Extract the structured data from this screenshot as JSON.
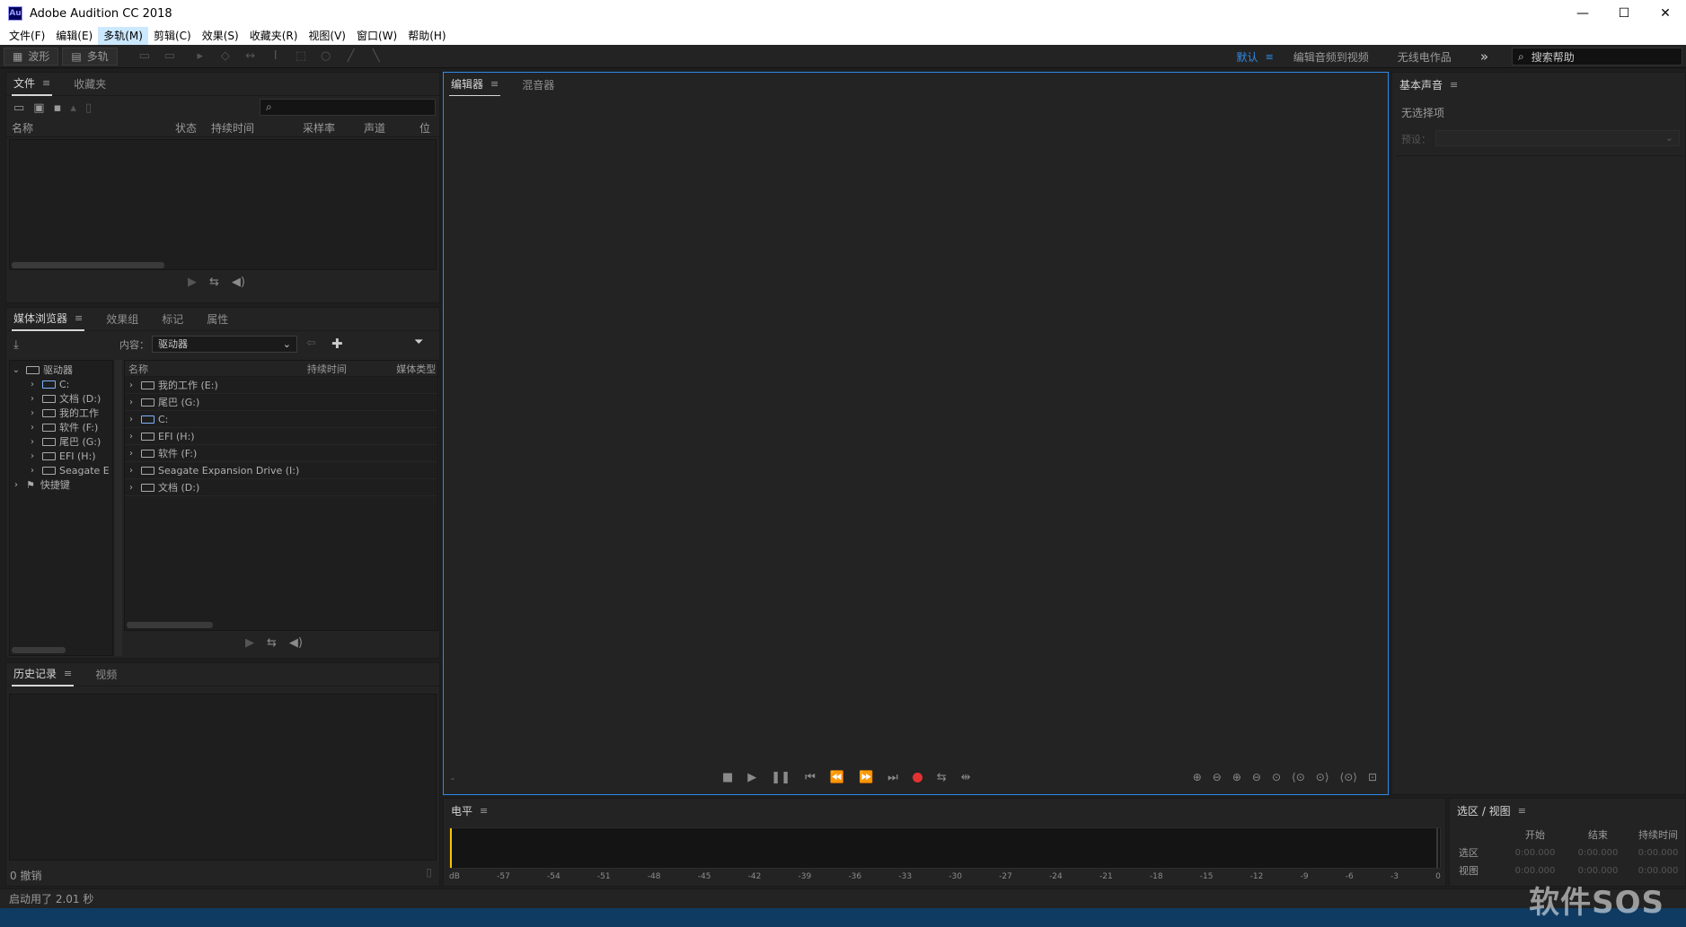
{
  "window": {
    "title": "Adobe Audition CC 2018",
    "app_icon": "Au",
    "minimize": "—",
    "maximize": "☐",
    "close": "✕"
  },
  "menu": [
    "文件(F)",
    "编辑(E)",
    "多轨(M)",
    "剪辑(C)",
    "效果(S)",
    "收藏夹(R)",
    "视图(V)",
    "窗口(W)",
    "帮助(H)"
  ],
  "toolbar": {
    "waveform_label": "波形",
    "multitrack_label": "多轨",
    "workspaces": [
      "默认",
      "编辑音频到视频",
      "无线电作品"
    ],
    "overflow": "»",
    "search_placeholder": "搜索帮助"
  },
  "files_panel": {
    "tabs": [
      "文件",
      "收藏夹"
    ],
    "columns": [
      "名称",
      "状态",
      "持续时间",
      "采样率",
      "声道",
      "位"
    ]
  },
  "media_browser": {
    "tabs": [
      "媒体浏览器",
      "效果组",
      "标记",
      "属性"
    ],
    "content_label": "内容：",
    "content_value": "驱动器",
    "tree_root": "驱动器",
    "tree": [
      "C:",
      "文档 (D:)",
      "我的工作",
      "软件 (F:)",
      "尾巴 (G:)",
      "EFI (H:)",
      "Seagate E"
    ],
    "shortcuts": "快捷键",
    "columns": [
      "名称",
      "持续时间",
      "媒体类型"
    ],
    "list": [
      "我的工作 (E:)",
      "尾巴 (G:)",
      "C:",
      "EFI (H:)",
      "软件 (F:)",
      "Seagate Expansion Drive (I:)",
      "文档 (D:)"
    ]
  },
  "history_panel": {
    "tabs": [
      "历史记录",
      "视频"
    ],
    "undo_status": "0 撤销"
  },
  "editor": {
    "tabs": [
      "编辑器",
      "混音器"
    ],
    "time_display": "-"
  },
  "essential_sound": {
    "title": "基本声音",
    "no_selection": "无选择项",
    "preset_label": "预设："
  },
  "level_meter": {
    "title": "电平",
    "scale": [
      "dB",
      "-57",
      "-54",
      "-51",
      "-48",
      "-45",
      "-42",
      "-39",
      "-36",
      "-33",
      "-30",
      "-27",
      "-24",
      "-21",
      "-18",
      "-15",
      "-12",
      "-9",
      "-6",
      "-3",
      "0"
    ]
  },
  "selection_view": {
    "title": "选区 / 视图",
    "headers": [
      "开始",
      "结束",
      "持续时间"
    ],
    "rows": [
      {
        "label": "选区",
        "values": [
          "0:00.000",
          "0:00.000",
          "0:00.000"
        ]
      },
      {
        "label": "视图",
        "values": [
          "0:00.000",
          "0:00.000",
          "0:00.000"
        ]
      }
    ]
  },
  "status": {
    "text": "启动用了 2.01 秒"
  },
  "watermark": "软件SOS",
  "colors": {
    "accent": "#2d8ceb",
    "record": "#e23232",
    "background": "#1e1e1e",
    "panel": "#232323"
  }
}
